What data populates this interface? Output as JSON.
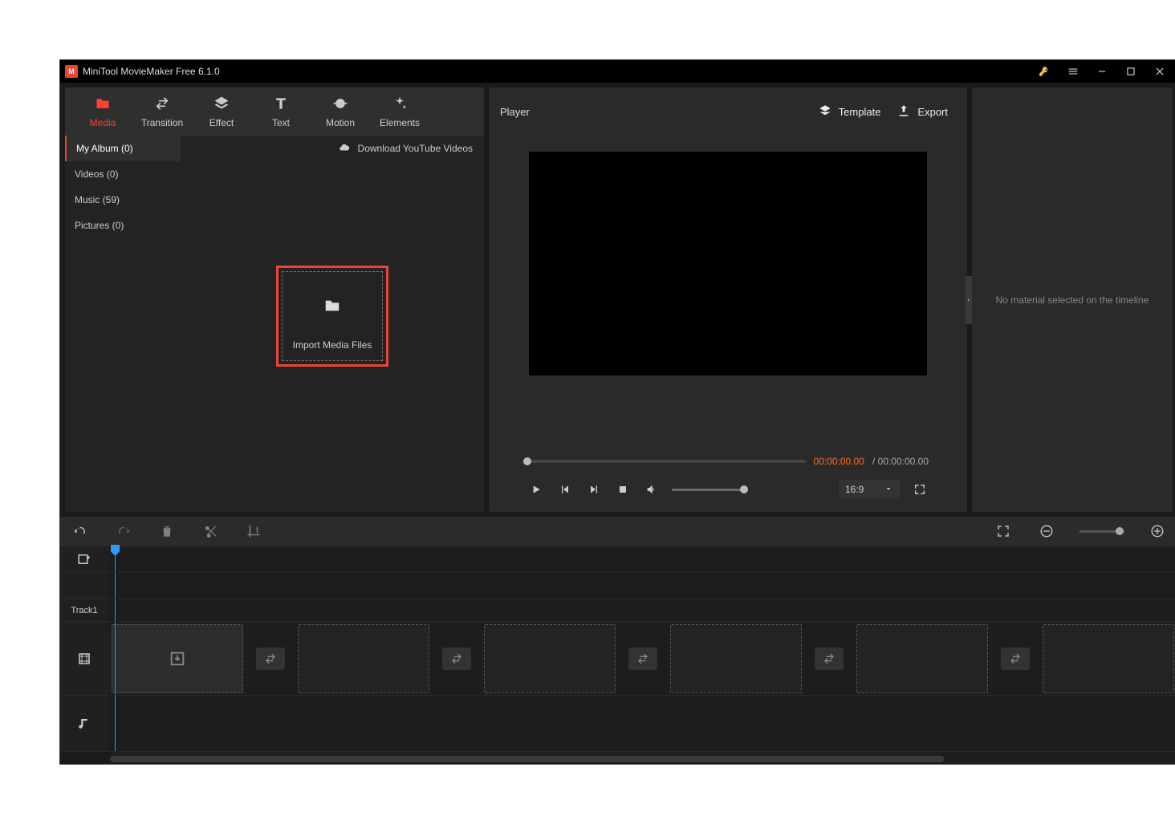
{
  "titlebar": {
    "title": "MiniTool MovieMaker Free 6.1.0"
  },
  "top_tabs": [
    {
      "label": "Media",
      "active": true
    },
    {
      "label": "Transition",
      "active": false
    },
    {
      "label": "Effect",
      "active": false
    },
    {
      "label": "Text",
      "active": false
    },
    {
      "label": "Motion",
      "active": false
    },
    {
      "label": "Elements",
      "active": false
    }
  ],
  "sidebar": {
    "items": [
      {
        "label": "My Album (0)",
        "active": true
      },
      {
        "label": "Videos (0)",
        "active": false
      },
      {
        "label": "Music (59)",
        "active": false
      },
      {
        "label": "Pictures (0)",
        "active": false
      }
    ]
  },
  "download_bar": {
    "label": "Download YouTube Videos"
  },
  "import_box": {
    "label": "Import Media Files"
  },
  "player": {
    "header": "Player",
    "template_btn": "Template",
    "export_btn": "Export",
    "current_time": "00:00:00.00",
    "duration": "00:00:00.00",
    "aspect_ratio": "16:9"
  },
  "properties": {
    "empty_msg": "No material selected on the timeline"
  },
  "timeline": {
    "track_label": "Track1"
  }
}
